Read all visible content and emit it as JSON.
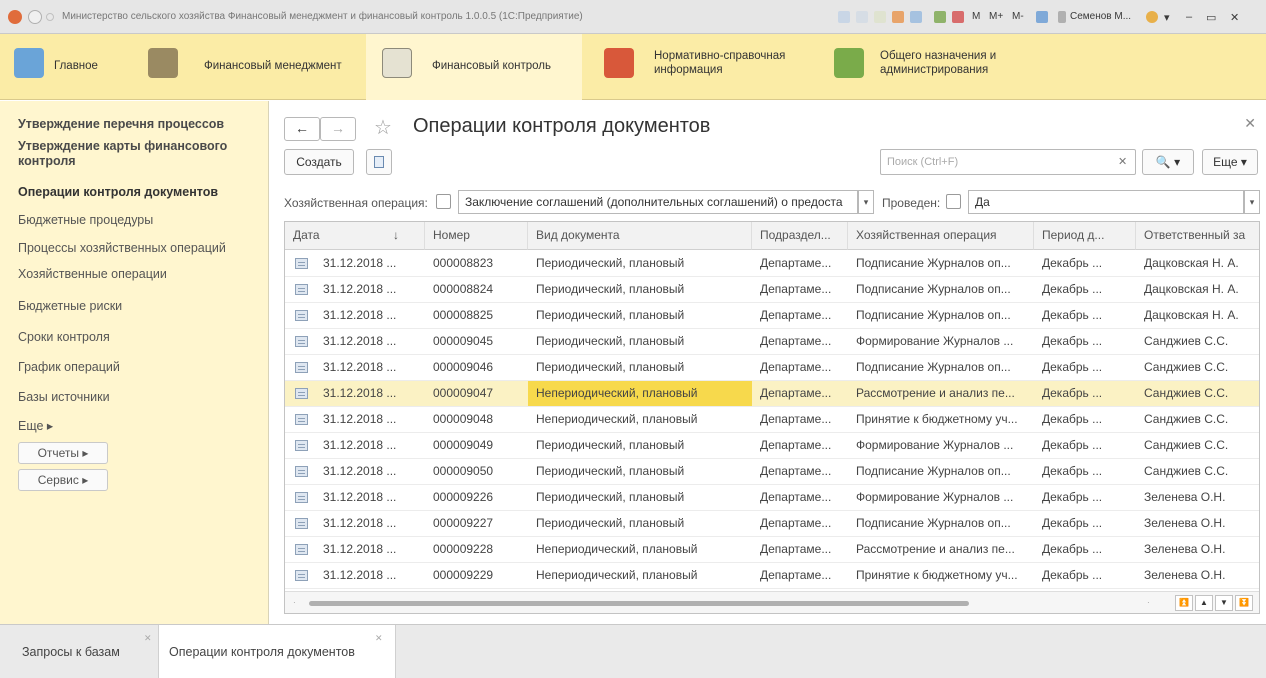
{
  "window": {
    "title": "Министерство сельского хозяйства Финансовый менеджмент и финансовый контроль 1.0.0.5 (1С:Предприятие)",
    "toolbar_labels": [
      "M",
      "M+",
      "M-"
    ],
    "user": "Семенов М..."
  },
  "sections": [
    {
      "label": "Главное"
    },
    {
      "label": "Финансовый менеджмент"
    },
    {
      "label": "Финансовый контроль"
    },
    {
      "label": "Нормативно-справочная информация"
    },
    {
      "label": "Общего назначения и администрирования"
    }
  ],
  "sidebar": {
    "items": [
      {
        "label": "Утверждение перечня процессов"
      },
      {
        "label": "Утверждение карты финансового контроля"
      },
      {
        "label": "Операции контроля документов"
      },
      {
        "label": "Бюджетные процедуры"
      },
      {
        "label": "Процессы хозяйственных операций"
      },
      {
        "label": "Хозяйственные операции"
      },
      {
        "label": "Бюджетные риски"
      },
      {
        "label": "Сроки контроля"
      },
      {
        "label": "График операций"
      },
      {
        "label": "Базы источники"
      },
      {
        "label": "Еще ▸"
      }
    ],
    "buttons": [
      {
        "label": "Отчеты ▸"
      },
      {
        "label": "Сервис ▸"
      }
    ]
  },
  "page": {
    "title": "Операции контроля документов",
    "create_label": "Создать",
    "search_placeholder": "Поиск (Ctrl+F)",
    "more_label": "Еще ▾",
    "search_btn_label": "🔍 ▾"
  },
  "filters": {
    "operation_label": "Хозяйственная операция:",
    "operation_value": "Заключение соглашений (дополнительных соглашений) о предоста",
    "posted_label": "Проведен:",
    "posted_value": "Да"
  },
  "table": {
    "columns": [
      "Дата",
      "Номер",
      "Вид документа",
      "Подраздел...",
      "Хозяйственная операция",
      "Период д...",
      "Ответственный за"
    ],
    "sort_indicator": "↓",
    "rows": [
      {
        "date": "31.12.2018 ...",
        "number": "000008823",
        "doc_type": "Периодический, плановый",
        "dept": "Департаме...",
        "operation": "Подписание Журналов оп...",
        "period": "Декабрь ...",
        "responsible": "Дацковская Н. А."
      },
      {
        "date": "31.12.2018 ...",
        "number": "000008824",
        "doc_type": "Периодический, плановый",
        "dept": "Департаме...",
        "operation": "Подписание Журналов оп...",
        "period": "Декабрь ...",
        "responsible": "Дацковская Н. А."
      },
      {
        "date": "31.12.2018 ...",
        "number": "000008825",
        "doc_type": "Периодический, плановый",
        "dept": "Департаме...",
        "operation": "Подписание Журналов оп...",
        "period": "Декабрь ...",
        "responsible": "Дацковская Н. А."
      },
      {
        "date": "31.12.2018 ...",
        "number": "000009045",
        "doc_type": "Периодический, плановый",
        "dept": "Департаме...",
        "operation": "Формирование Журналов ...",
        "period": "Декабрь ...",
        "responsible": "Санджиев С.С."
      },
      {
        "date": "31.12.2018 ...",
        "number": "000009046",
        "doc_type": "Периодический, плановый",
        "dept": "Департаме...",
        "operation": "Подписание Журналов оп...",
        "period": "Декабрь ...",
        "responsible": "Санджиев С.С."
      },
      {
        "date": "31.12.2018 ...",
        "number": "000009047",
        "doc_type": "Непериодический, плановый",
        "dept": "Департаме...",
        "operation": "Рассмотрение и анализ пе...",
        "period": "Декабрь ...",
        "responsible": "Санджиев С.С.",
        "selected": true
      },
      {
        "date": "31.12.2018 ...",
        "number": "000009048",
        "doc_type": "Непериодический, плановый",
        "dept": "Департаме...",
        "operation": "Принятие к бюджетному уч...",
        "period": "Декабрь ...",
        "responsible": "Санджиев С.С."
      },
      {
        "date": "31.12.2018 ...",
        "number": "000009049",
        "doc_type": "Периодический, плановый",
        "dept": "Департаме...",
        "operation": "Формирование Журналов ...",
        "period": "Декабрь ...",
        "responsible": "Санджиев С.С."
      },
      {
        "date": "31.12.2018 ...",
        "number": "000009050",
        "doc_type": "Периодический, плановый",
        "dept": "Департаме...",
        "operation": "Подписание Журналов оп...",
        "period": "Декабрь ...",
        "responsible": "Санджиев С.С."
      },
      {
        "date": "31.12.2018 ...",
        "number": "000009226",
        "doc_type": "Периодический, плановый",
        "dept": "Департаме...",
        "operation": "Формирование Журналов ...",
        "period": "Декабрь ...",
        "responsible": "Зеленева О.Н."
      },
      {
        "date": "31.12.2018 ...",
        "number": "000009227",
        "doc_type": "Периодический, плановый",
        "dept": "Департаме...",
        "operation": "Подписание Журналов оп...",
        "period": "Декабрь ...",
        "responsible": "Зеленева О.Н."
      },
      {
        "date": "31.12.2018 ...",
        "number": "000009228",
        "doc_type": "Непериодический, плановый",
        "dept": "Департаме...",
        "operation": "Рассмотрение и анализ пе...",
        "period": "Декабрь ...",
        "responsible": "Зеленева О.Н."
      },
      {
        "date": "31.12.2018 ...",
        "number": "000009229",
        "doc_type": "Непериодический, плановый",
        "dept": "Департаме...",
        "operation": "Принятие к бюджетному уч...",
        "period": "Декабрь ...",
        "responsible": "Зеленева О.Н."
      }
    ]
  },
  "bottom_tabs": [
    {
      "label": "Запросы к базам"
    },
    {
      "label": "Операции контроля документов"
    }
  ],
  "colors": {
    "section_bar": "#fbeca6",
    "sidebar": "#fff6cf",
    "selected_row": "#fbf2c4",
    "selected_cell": "#f7d94c"
  }
}
